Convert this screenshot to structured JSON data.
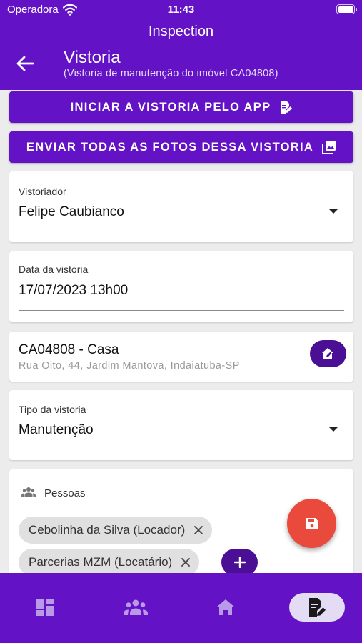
{
  "status_bar": {
    "carrier": "Operadora",
    "time": "11:43"
  },
  "header": {
    "app_name": "Inspection",
    "title": "Vistoria",
    "subtitle": "(Vistoria de manutenção do imóvel CA04808)"
  },
  "actions": {
    "start_inspection": "INICIAR A VISTORIA PELO APP",
    "send_photos": "ENVIAR TODAS AS FOTOS DESSA VISTORIA"
  },
  "inspector": {
    "label": "Vistoriador",
    "value": "Felipe Caubianco"
  },
  "date": {
    "label": "Data da vistoria",
    "value": "17/07/2023 13h00"
  },
  "property": {
    "title": "CA04808 - Casa",
    "address": "Rua Oito, 44, Jardim Mantova, Indaiatuba-SP"
  },
  "inspection_type": {
    "label": "Tipo da vistoria",
    "value": "Manutenção"
  },
  "people": {
    "label": "Pessoas",
    "chips": [
      "Cebolinha da Silva (Locador)",
      "Parcerias MZM (Locatário)"
    ]
  },
  "bottom_nav": {
    "items": [
      "dashboard-icon",
      "people-icon",
      "home-icon",
      "inspection-edit-icon"
    ],
    "active": "inspection-edit-icon"
  },
  "colors": {
    "primary": "#6412c6",
    "primary_dark": "#4b0f96",
    "fab": "#ea4a3c",
    "background": "#ececec"
  }
}
